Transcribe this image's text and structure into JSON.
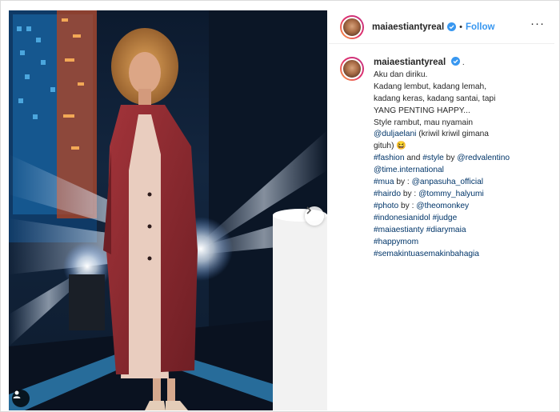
{
  "post": {
    "header": {
      "username": "maiaestiantyreal",
      "separator": "•",
      "follow_label": "Follow",
      "more_icon": "more-icon"
    },
    "caption": {
      "username": "maiaestiantyreal",
      "username_suffix": ".",
      "lines": [
        {
          "text": "Aku dan diriku.",
          "type": "text"
        },
        {
          "text": "Kadang lembut, kadang lemah,",
          "type": "text"
        },
        {
          "text": "kadang keras, kadang santai, tapi",
          "type": "text"
        },
        {
          "text": "YANG PENTING HAPPY...",
          "type": "text"
        },
        {
          "text": "Style rambut, mau nyamain",
          "type": "text"
        },
        {
          "mention": "@duljaelani",
          "rest": " (kriwil kriwil gimana",
          "type": "mixed"
        },
        {
          "text": "gituh) 😆",
          "type": "text"
        },
        {
          "a": "#fashion",
          "b": " and ",
          "c": "#style",
          "d": " by ",
          "e": "@redvalentino",
          "type": "tags5"
        },
        {
          "text": "@time.international",
          "type": "link"
        },
        {
          "a": "#mua",
          "b": " by : ",
          "c": "@anpasuha_official",
          "type": "tags3"
        },
        {
          "a": "#hairdo",
          "b": " by : ",
          "c": "@tommy_halyumi",
          "type": "tags3"
        },
        {
          "a": "#photo",
          "b": " by : ",
          "c": "@theomonkey",
          "type": "tags3"
        },
        {
          "a": "#indonesianidol",
          "b": " ",
          "c": "#judge",
          "type": "tags3"
        },
        {
          "a": "#maiaestianty",
          "b": " ",
          "c": "#diarymaia",
          "type": "tags3"
        },
        {
          "text": "#happymom",
          "type": "link"
        },
        {
          "text": "#semakintuasemakinbahagia",
          "type": "link"
        }
      ]
    },
    "colors": {
      "link": "#003569",
      "follow": "#3897f0",
      "verified": "#3897f0",
      "coat": "#8e2a2e"
    }
  }
}
